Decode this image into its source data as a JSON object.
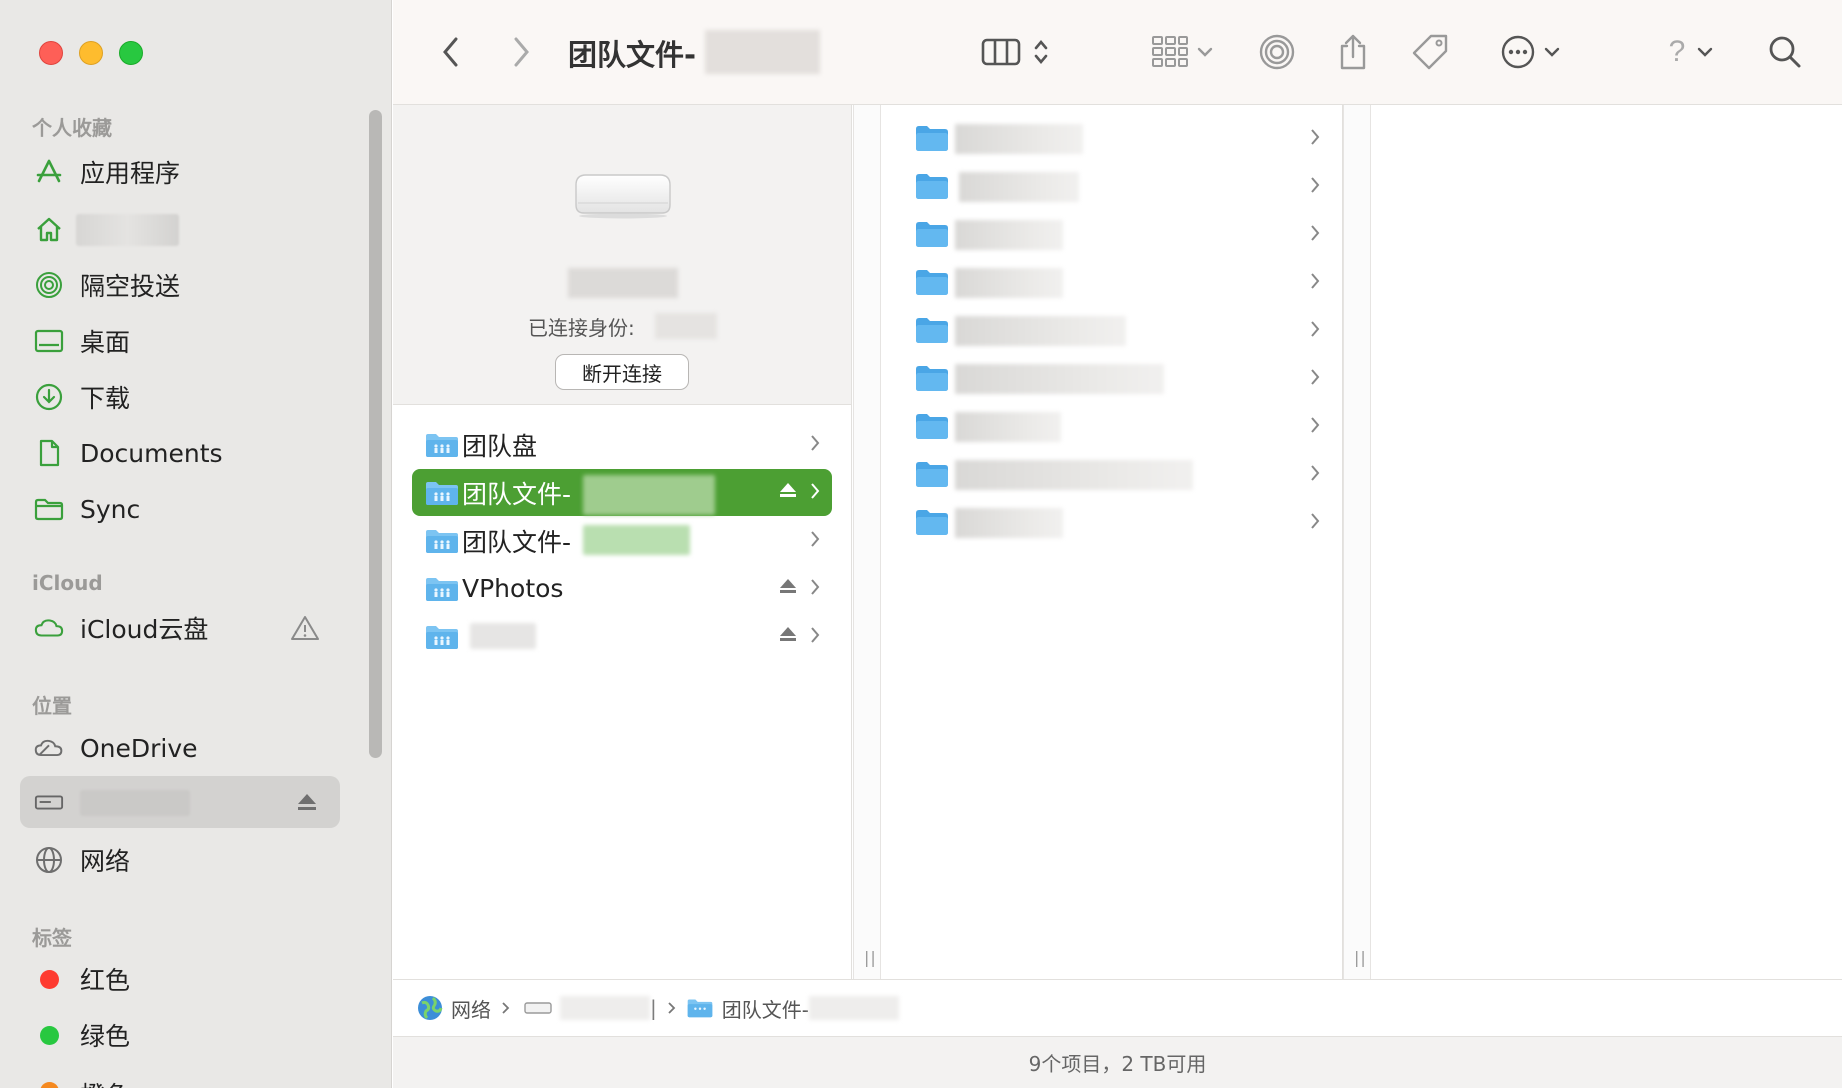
{
  "window": {
    "title_prefix": "团队文件-"
  },
  "sidebar": {
    "sections": {
      "favorites": "个人收藏",
      "icloud": "iCloud",
      "locations": "位置",
      "tags": "标签"
    },
    "favorites": [
      {
        "label": "应用程序",
        "icon": "applications-icon"
      },
      {
        "label": "",
        "icon": "home-icon"
      },
      {
        "label": "隔空投送",
        "icon": "airdrop-icon"
      },
      {
        "label": "桌面",
        "icon": "desktop-icon"
      },
      {
        "label": "下载",
        "icon": "downloads-icon"
      },
      {
        "label": "Documents",
        "icon": "document-icon"
      },
      {
        "label": "Sync",
        "icon": "folder-icon"
      }
    ],
    "icloud": [
      {
        "label": "iCloud云盘",
        "icon": "cloud-icon"
      }
    ],
    "locations": [
      {
        "label": "OneDrive",
        "icon": "onedrive-cloud-icon"
      },
      {
        "label": "",
        "icon": "drive-icon"
      },
      {
        "label": "网络",
        "icon": "network-globe-icon"
      }
    ],
    "tags": [
      {
        "label": "红色",
        "color": "#fe3b30"
      },
      {
        "label": "绿色",
        "color": "#28c840"
      },
      {
        "label": "橙色",
        "color": "#f5891f"
      }
    ]
  },
  "server": {
    "connected_as_label": "已连接身份:",
    "disconnect_label": "断开连接"
  },
  "shares": [
    {
      "label": "团队盘",
      "eject": false,
      "selected": false
    },
    {
      "label": "团队文件-",
      "eject": true,
      "selected": true
    },
    {
      "label": "团队文件-",
      "eject": false,
      "selected": false
    },
    {
      "label": "VPhotos",
      "eject": true,
      "selected": false
    },
    {
      "label": "",
      "eject": true,
      "selected": false
    }
  ],
  "folders_count": 9,
  "pathbar": {
    "network": "网络",
    "folder": "团队文件-"
  },
  "status": {
    "text": "9个项目，2 TB可用"
  },
  "colors": {
    "accent": "#4c9f33",
    "sidebar_icon": "#3aa03c",
    "folder_blue": "#5fb4ec"
  }
}
